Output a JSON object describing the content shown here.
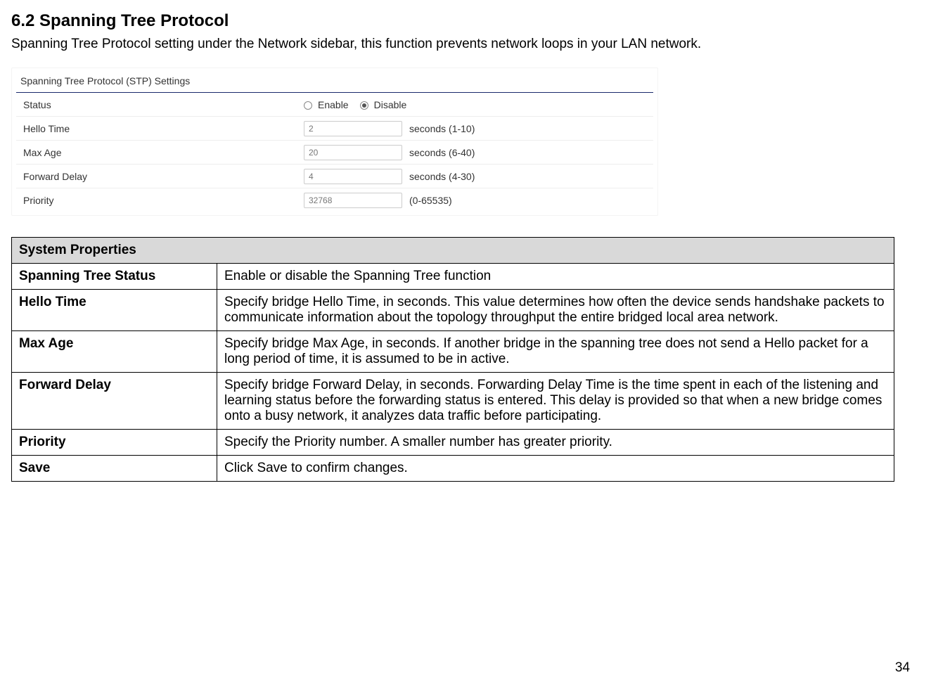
{
  "heading": "6.2   Spanning Tree Protocol",
  "intro": "Spanning Tree Protocol setting under the Network sidebar, this function prevents network loops in your LAN network.",
  "settings": {
    "title": "Spanning Tree Protocol (STP) Settings",
    "rows": {
      "status_label": "Status",
      "enable_label": "Enable",
      "disable_label": "Disable",
      "hello_label": "Hello Time",
      "hello_value": "2",
      "hello_range": "seconds (1-10)",
      "maxage_label": "Max Age",
      "maxage_value": "20",
      "maxage_range": "seconds (6-40)",
      "forward_label": "Forward Delay",
      "forward_value": "4",
      "forward_range": "seconds (4-30)",
      "priority_label": "Priority",
      "priority_value": "32768",
      "priority_range": "(0-65535)"
    }
  },
  "properties": {
    "header": "System Properties",
    "rows": [
      {
        "name": "Spanning Tree Status",
        "desc": "Enable or disable the Spanning Tree function"
      },
      {
        "name": "Hello Time",
        "desc": "Specify bridge Hello Time, in seconds. This value determines how often the device sends handshake packets to communicate information about the topology throughput the entire bridged local area network."
      },
      {
        "name": "Max Age",
        "desc": "Specify bridge Max Age, in seconds. If another bridge in the spanning tree does not send a Hello packet for a long period of time, it is assumed to be in active."
      },
      {
        "name": "Forward Delay",
        "desc": "Specify bridge Forward Delay, in seconds. Forwarding Delay Time is the time spent in each of the listening and learning status before the forwarding status is entered. This delay is provided so that when a new bridge comes onto a busy network, it analyzes data traffic before participating."
      },
      {
        "name": "Priority",
        "desc": "Specify the Priority number. A smaller number has greater priority."
      },
      {
        "name": "Save",
        "desc": "Click Save to confirm changes."
      }
    ]
  },
  "page_number": "34"
}
